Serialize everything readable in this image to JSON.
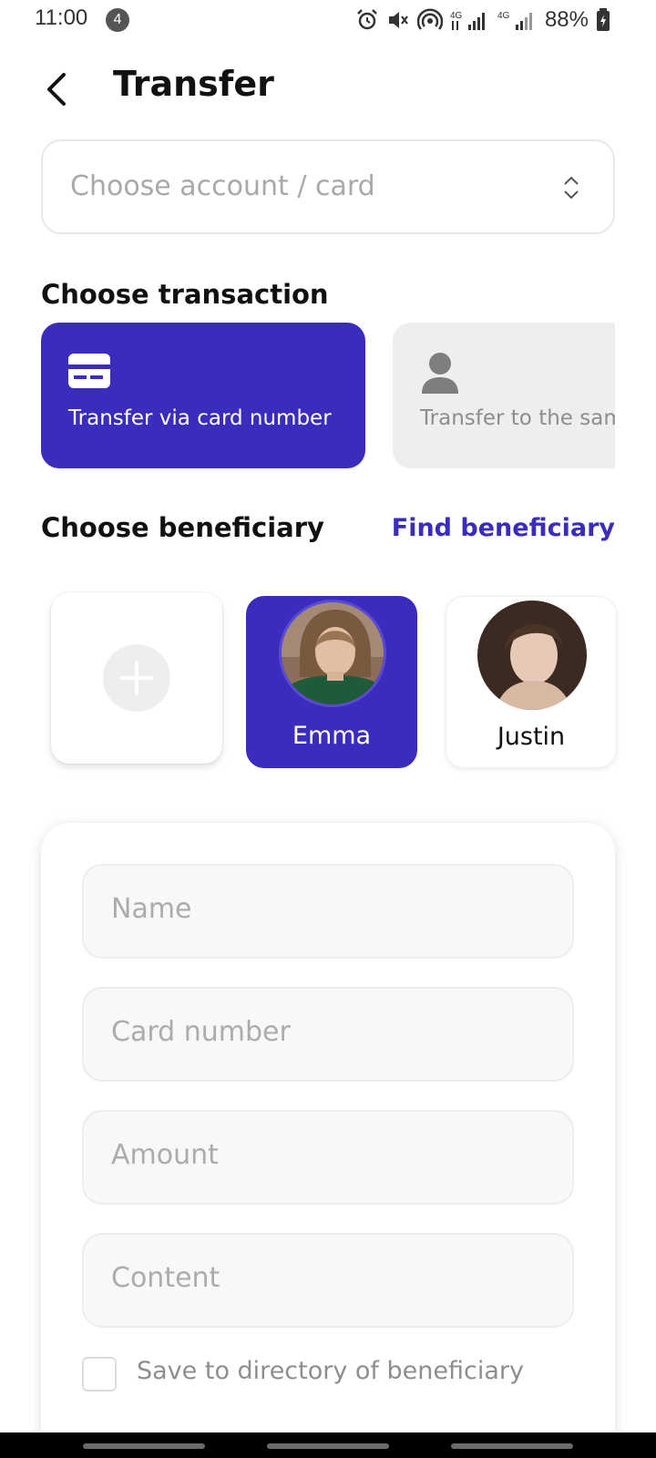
{
  "status_bar": {
    "time": "11:00",
    "notification_count": "4",
    "battery_percent": "88%",
    "icons": [
      "alarm-icon",
      "mute-icon",
      "hotspot-icon",
      "signal-4g-icon",
      "signal-4g-icon",
      "battery-charging-icon"
    ]
  },
  "header": {
    "title": "Transfer",
    "back_icon": "chevron-left-icon"
  },
  "account_select": {
    "placeholder": "Choose account / card",
    "icon": "unfold-icon"
  },
  "transaction": {
    "section_title": "Choose transaction",
    "options": [
      {
        "label": "Transfer via card number",
        "icon": "card-icon",
        "selected": true
      },
      {
        "label": "Transfer to the same bank",
        "icon": "person-icon",
        "selected": false
      }
    ]
  },
  "beneficiary": {
    "section_title": "Choose beneficiary",
    "find_link": "Find beneficiary",
    "items": [
      {
        "name": "Emma",
        "selected": true
      },
      {
        "name": "Justin",
        "selected": false
      }
    ]
  },
  "form": {
    "fields": [
      {
        "placeholder": "Name"
      },
      {
        "placeholder": "Card number"
      },
      {
        "placeholder": "Amount"
      },
      {
        "placeholder": "Content"
      }
    ],
    "save_label": "Save to directory of beneficiary",
    "save_checked": false
  },
  "colors": {
    "accent": "#3a2cbd",
    "inactive_card": "#eeeeee",
    "placeholder": "#acacae"
  }
}
